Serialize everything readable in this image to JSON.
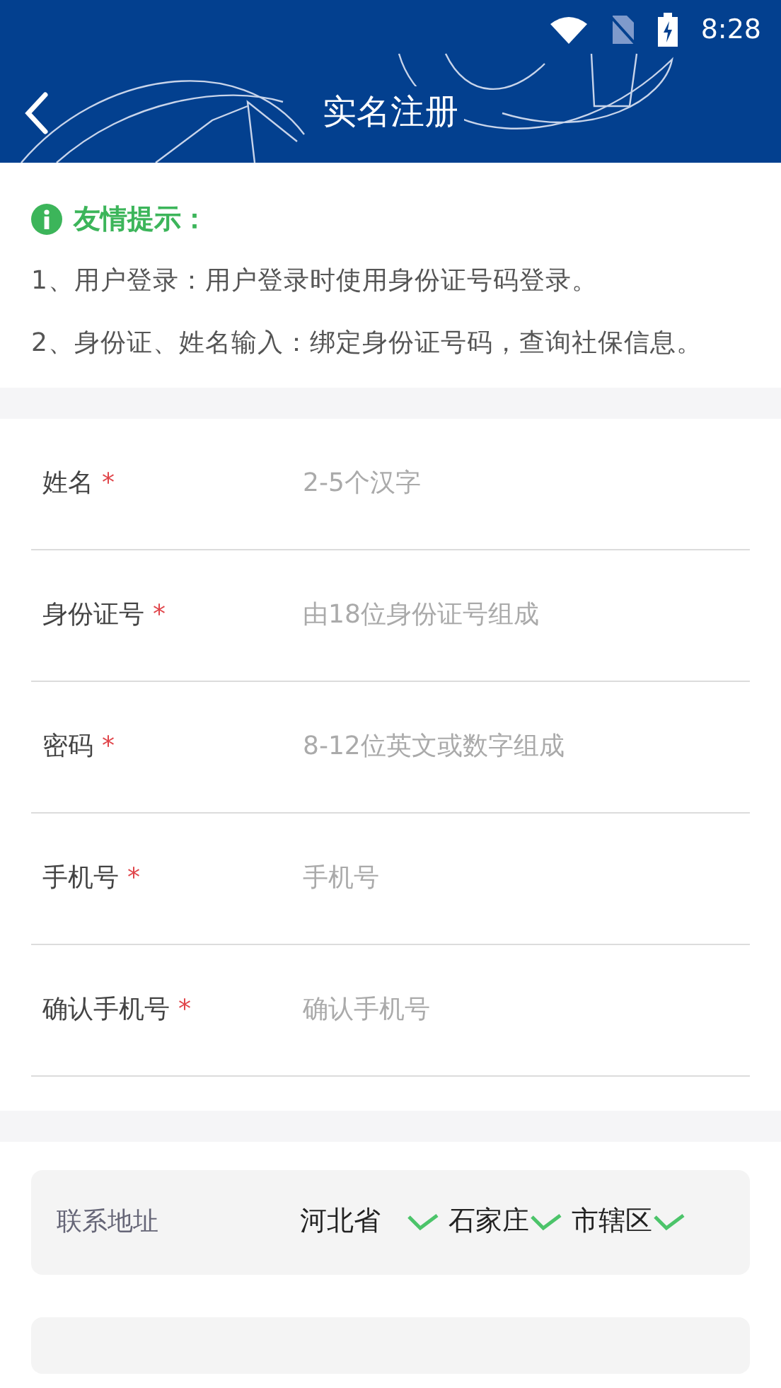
{
  "status_bar": {
    "time": "8:28"
  },
  "header": {
    "title": "实名注册"
  },
  "notice": {
    "title": "友情提示：",
    "items": [
      "1、用户登录：用户登录时使用身份证号码登录。",
      "2、身份证、姓名输入：绑定身份证号码，查询社保信息。"
    ]
  },
  "fields": [
    {
      "label": "姓名",
      "required_mark": "*",
      "placeholder": "2-5个汉字"
    },
    {
      "label": "身份证号",
      "required_mark": "*",
      "placeholder": "由18位身份证号组成"
    },
    {
      "label": "密码",
      "required_mark": "*",
      "placeholder": "8-12位英文或数字组成"
    },
    {
      "label": "手机号",
      "required_mark": "*",
      "placeholder": "手机号"
    },
    {
      "label": "确认手机号",
      "required_mark": "*",
      "placeholder": "确认手机号"
    }
  ],
  "address": {
    "label": "联系地址",
    "parts": [
      "河北省",
      "石家庄",
      "市辖区"
    ]
  }
}
